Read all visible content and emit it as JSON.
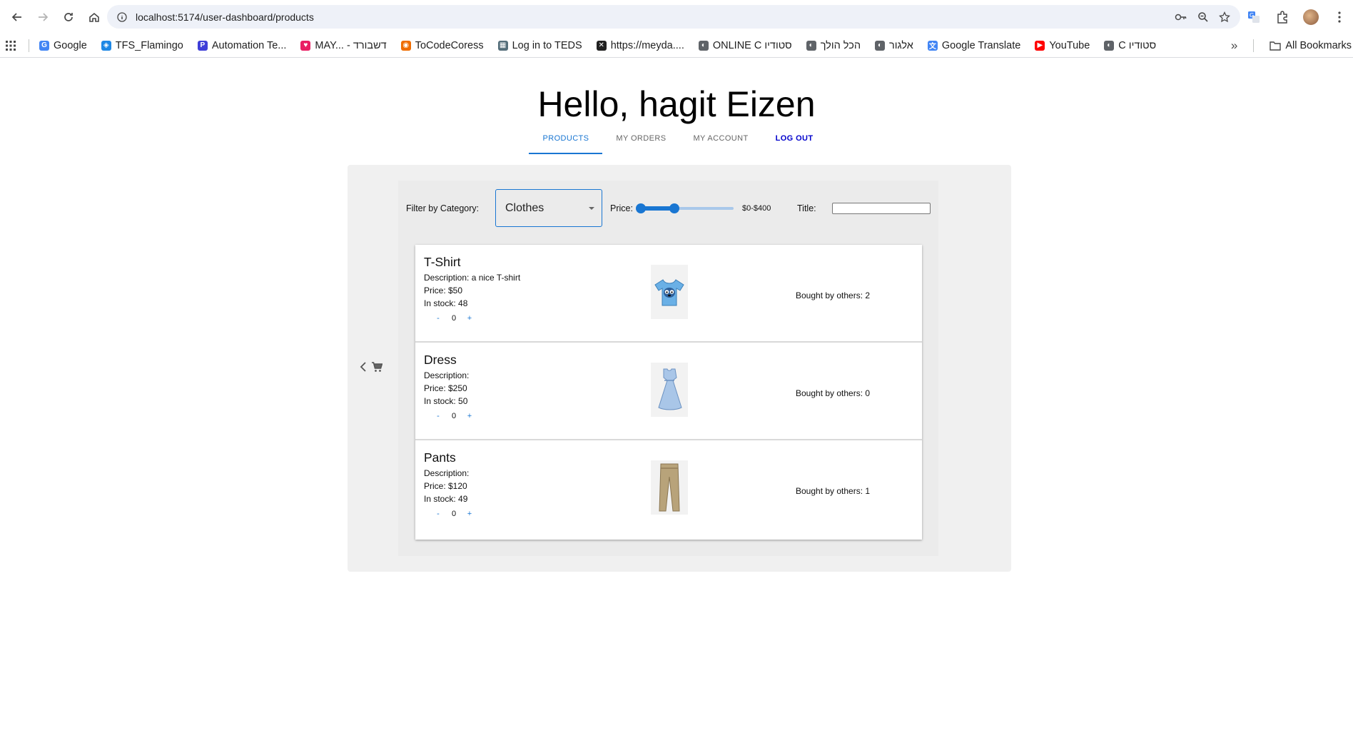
{
  "browser": {
    "url": "localhost:5174/user-dashboard/products",
    "bookmarks": [
      {
        "label": "Google",
        "color": "#4285f4",
        "glyph": "G"
      },
      {
        "label": "TFS_Flamingo",
        "color": "#1e88e5",
        "glyph": "◈"
      },
      {
        "label": "Automation Te...",
        "color": "#3f3fd8",
        "glyph": "P"
      },
      {
        "label": "MAY... - דשבורד",
        "color": "#e91e63",
        "glyph": "♥"
      },
      {
        "label": "ToCodeCoress",
        "color": "#ef6c00",
        "glyph": "◉"
      },
      {
        "label": "Log in to TEDS",
        "color": "#546e7a",
        "glyph": "▦"
      },
      {
        "label": "https://meyda....",
        "color": "#212121",
        "glyph": "✕"
      },
      {
        "label": "ONLINE C סטודיו",
        "color": "#5f6368",
        "glyph": "◐"
      },
      {
        "label": "הכל הולך",
        "color": "#5f6368",
        "glyph": "◐"
      },
      {
        "label": "אלגור",
        "color": "#5f6368",
        "glyph": "◐"
      },
      {
        "label": "Google Translate",
        "color": "#4285f4",
        "glyph": "文"
      },
      {
        "label": "YouTube",
        "color": "#ff0000",
        "glyph": "▶"
      },
      {
        "label": "C סטודיו",
        "color": "#5f6368",
        "glyph": "◐"
      }
    ],
    "more_label": "»",
    "all_bookmarks_label": "All Bookmarks"
  },
  "page": {
    "greeting": "Hello, hagit Eizen",
    "tabs": [
      "PRODUCTS",
      "MY ORDERS",
      "MY ACCOUNT",
      "LOG OUT"
    ],
    "active_tab": "PRODUCTS",
    "accent_color": "#1976d2"
  },
  "filters": {
    "category_label": "Filter by Category:",
    "category_value": "Clothes",
    "price_label": "Price:",
    "price_range_text": "$0-$400",
    "price_min": 0,
    "price_max": 400,
    "price_low_fraction": 0.0,
    "price_high_fraction": 0.36,
    "title_label": "Title:",
    "title_value": ""
  },
  "products": [
    {
      "name": "T-Shirt",
      "description": "Description: a nice T-shirt",
      "price": "Price: $50",
      "stock": "In stock: 48",
      "qty": "0",
      "minus": "-",
      "plus": "+",
      "bought": "Bought by others: 2",
      "image": "tshirt-image"
    },
    {
      "name": "Dress",
      "description": "Description:",
      "price": "Price: $250",
      "stock": "In stock: 50",
      "qty": "0",
      "minus": "-",
      "plus": "+",
      "bought": "Bought by others: 0",
      "image": "dress-image"
    },
    {
      "name": "Pants",
      "description": "Description:",
      "price": "Price: $120",
      "stock": "In stock: 49",
      "qty": "0",
      "minus": "-",
      "plus": "+",
      "bought": "Bought by others: 1",
      "image": "pants-image"
    }
  ],
  "cart": {
    "icons": [
      "chevron-left-icon",
      "cart-icon"
    ]
  }
}
